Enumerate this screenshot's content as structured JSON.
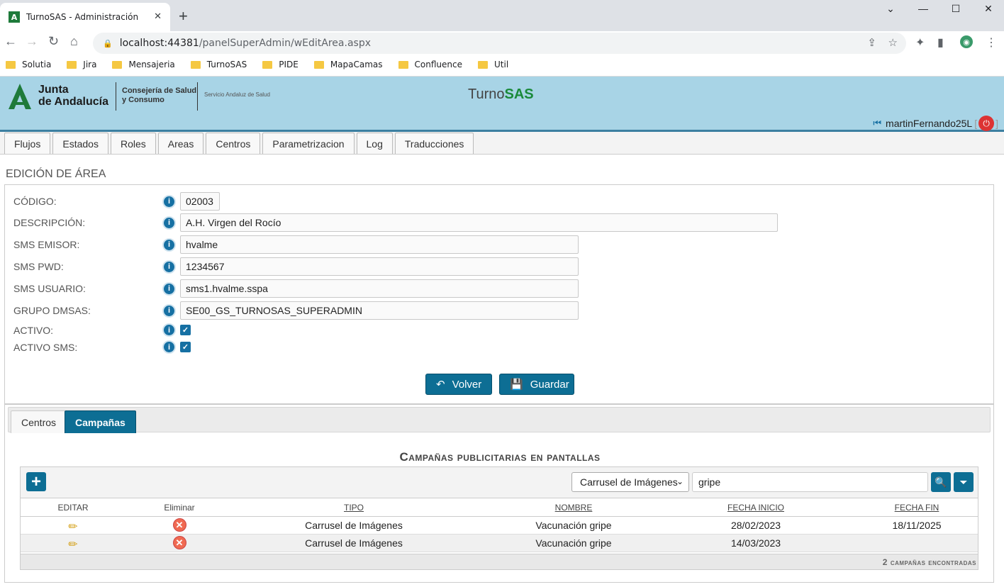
{
  "browser": {
    "tab_title": "TurnoSAS - Administración",
    "url_host": "localhost:44381",
    "url_path": "/panelSuperAdmin/wEditArea.aspx",
    "bookmarks": [
      "Solutia",
      "Jira",
      "Mensajeria",
      "TurnoSAS",
      "PIDE",
      "MapaCamas",
      "Confluence",
      "Util"
    ]
  },
  "header": {
    "logo_line1": "Junta",
    "logo_line2": "de Andalucía",
    "consejeria_line1": "Consejería de Salud",
    "consejeria_line2": "y Consumo",
    "sas": "Servicio Andaluz de Salud",
    "app_name_a": "Turno",
    "app_name_b": "SAS",
    "username": "martinFernando25L"
  },
  "menu": [
    "Flujos",
    "Estados",
    "Roles",
    "Areas",
    "Centros",
    "Parametrizacion",
    "Log",
    "Traducciones"
  ],
  "page_title": "EDICIÓN DE ÁREA",
  "form": {
    "codigo_label": "CÓDIGO:",
    "codigo_value": "02003",
    "descripcion_label": "DESCRIPCIÓN:",
    "descripcion_value": "A.H. Virgen del Rocío",
    "sms_emisor_label": "SMS EMISOR:",
    "sms_emisor_value": "hvalme",
    "sms_pwd_label": "SMS PWD:",
    "sms_pwd_value": "1234567",
    "sms_usuario_label": "SMS USUARIO:",
    "sms_usuario_value": "sms1.hvalme.sspa",
    "grupo_label": "GRUPO DMSAS:",
    "grupo_value": "SE00_GS_TURNOSAS_SUPERADMIN",
    "activo_label": "ACTIVO:",
    "activo_sms_label": "ACTIVO SMS:",
    "volver": "Volver",
    "guardar": "Guardar"
  },
  "subtabs": [
    "Centros",
    "Campañas"
  ],
  "campaigns": {
    "title": "Campañas publicitarias en pantallas",
    "type_select": "Carrusel de Imágenes",
    "search_value": "gripe",
    "headers": [
      "EDITAR",
      "Eliminar",
      "TIPO",
      "NOMBRE",
      "FECHA INICIO",
      "FECHA FIN"
    ],
    "rows": [
      {
        "tipo": "Carrusel de Imágenes",
        "nombre": "Vacunación gripe",
        "inicio": "28/02/2023",
        "fin": "18/11/2025"
      },
      {
        "tipo": "Carrusel de Imágenes",
        "nombre": "Vacunación gripe",
        "inicio": "14/03/2023",
        "fin": ""
      }
    ],
    "footer_count": "2",
    "footer_text": "campañas encontradas"
  }
}
